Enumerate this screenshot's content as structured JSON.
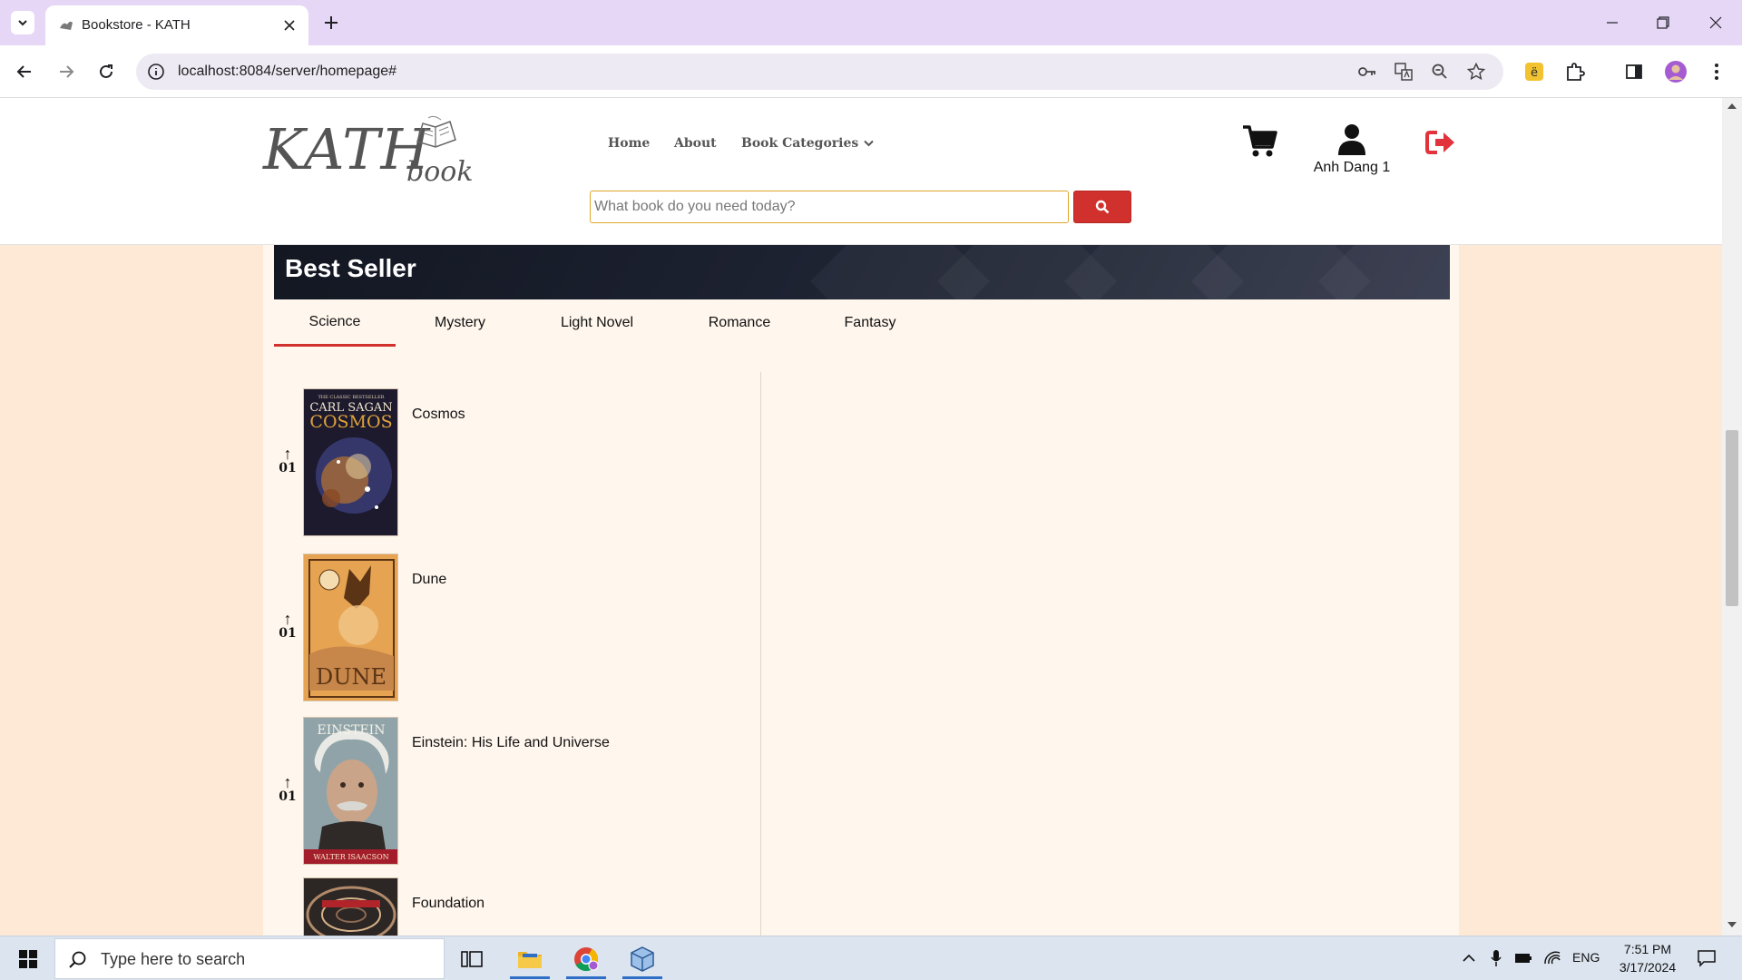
{
  "browser": {
    "tab_title": "Bookstore - KATH",
    "url": "localhost:8084/server/homepage#"
  },
  "site": {
    "logo_text": "KATH",
    "logo_sub": "book",
    "nav": {
      "home": "Home",
      "about": "About",
      "categories": "Book Categories"
    },
    "search_placeholder": "What book do you need today?",
    "user_name": "Anh Dang 1"
  },
  "bestseller": {
    "title": "Best Seller",
    "tabs": [
      "Science",
      "Mystery",
      "Light Novel",
      "Romance",
      "Fantasy"
    ],
    "active_tab": "Science",
    "books": [
      {
        "rank": "01",
        "title": "Cosmos",
        "cover": {
          "top_text": "THE CLASSIC BESTSELLER",
          "author": "CARL SAGAN",
          "name": "COSMOS"
        }
      },
      {
        "rank": "01",
        "title": "Dune",
        "cover": {
          "name": "DUNE"
        }
      },
      {
        "rank": "01",
        "title": "Einstein: His Life and Universe",
        "cover": {
          "name": "EINSTEIN",
          "author": "WALTER ISAACSON"
        }
      },
      {
        "title": "Foundation"
      }
    ]
  },
  "taskbar": {
    "search_placeholder": "Type here to search",
    "language": "ENG",
    "time": "7:51 PM",
    "date": "3/17/2024"
  },
  "colors": {
    "accent_red": "#d0312d",
    "page_bg": "#fde9d6",
    "content_bg": "#fff6ed",
    "banner_dark": "#1c2130",
    "tab_strip": "#e6d7f7"
  }
}
